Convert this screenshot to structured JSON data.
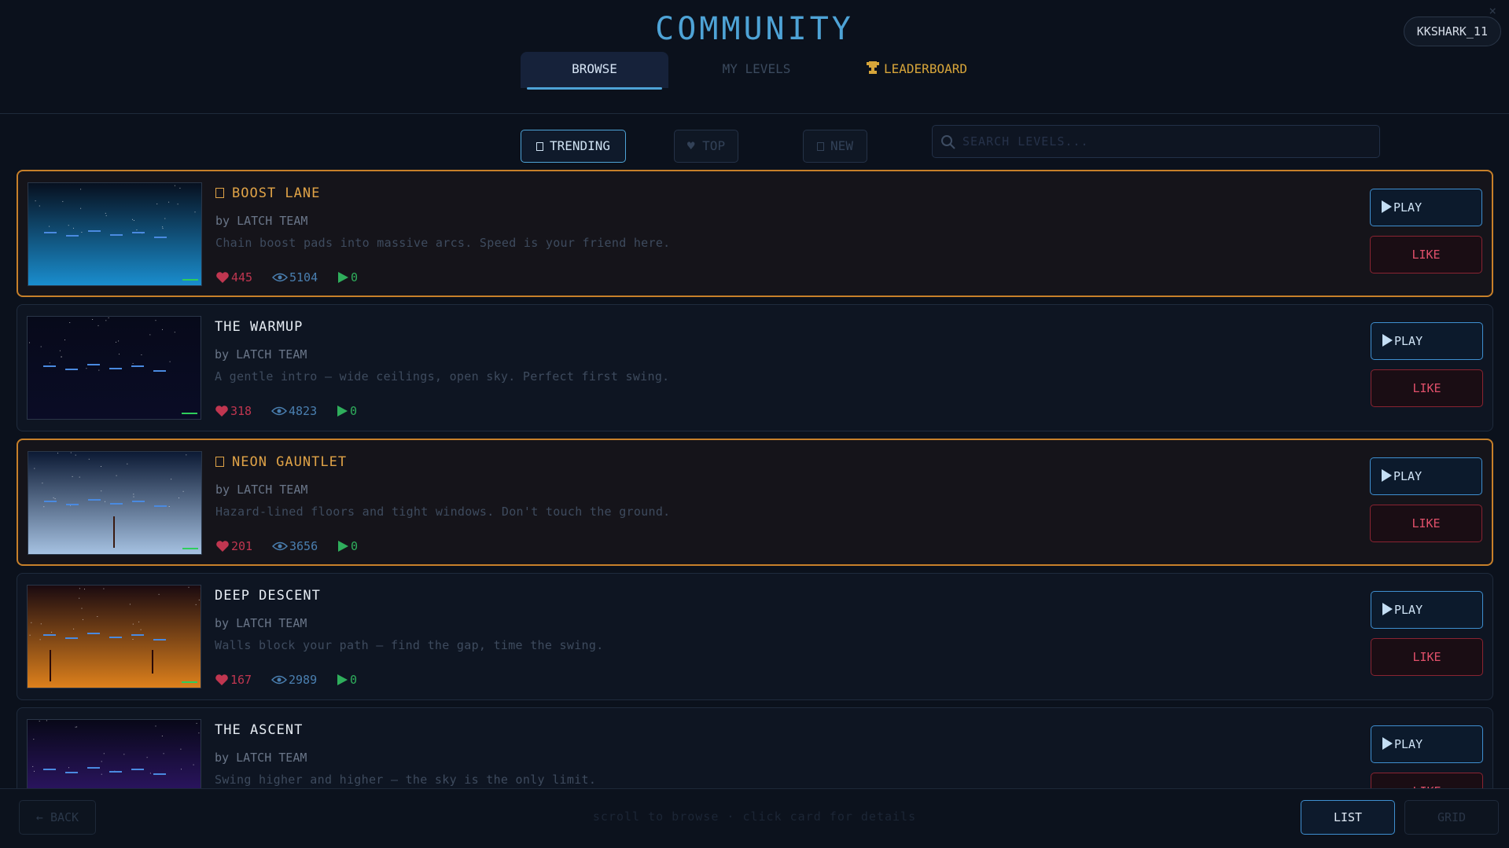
{
  "header": {
    "title": "COMMUNITY",
    "username": "KKSHARK_11",
    "tabs": [
      {
        "label": "BROWSE",
        "active": true
      },
      {
        "label": "MY LEVELS",
        "active": false
      },
      {
        "label": "LEADERBOARD",
        "active": false,
        "icon": "trophy-icon"
      }
    ]
  },
  "filters": {
    "items": [
      {
        "label": "TRENDING",
        "icon": "square-glyph",
        "active": true
      },
      {
        "label": "♥ TOP",
        "active": false
      },
      {
        "label": "NEW",
        "icon": "square-glyph",
        "active": false
      }
    ],
    "search_placeholder": "SEARCH LEVELS..."
  },
  "levels": [
    {
      "title": "BOOST LANE",
      "featured": true,
      "author": "by LATCH TEAM",
      "description": "Chain boost pads into massive arcs. Speed is your friend here.",
      "likes": "445",
      "views": "5104",
      "plays": "0",
      "theme": {
        "top": "#07101f",
        "bottom": "#1a8fd0"
      }
    },
    {
      "title": "THE WARMUP",
      "featured": false,
      "author": "by LATCH TEAM",
      "description": "A gentle intro — wide ceilings, open sky. Perfect first swing.",
      "likes": "318",
      "views": "4823",
      "plays": "0",
      "theme": {
        "top": "#070a1a",
        "bottom": "#0a0c26"
      }
    },
    {
      "title": "NEON GAUNTLET",
      "featured": true,
      "author": "by LATCH TEAM",
      "description": "Hazard-lined floors and tight windows. Don't touch the ground.",
      "likes": "201",
      "views": "3656",
      "plays": "0",
      "theme": {
        "top": "#0c1a34",
        "bottom": "#a8c4e4"
      }
    },
    {
      "title": "DEEP DESCENT",
      "featured": false,
      "author": "by LATCH TEAM",
      "description": "Walls block your path — find the gap, time the swing.",
      "likes": "167",
      "views": "2989",
      "plays": "0",
      "theme": {
        "top": "#1a0a10",
        "bottom": "#e0821c"
      }
    },
    {
      "title": "THE ASCENT",
      "featured": false,
      "author": "by LATCH TEAM",
      "description": "Swing higher and higher — the sky is the only limit.",
      "likes": "",
      "views": "",
      "plays": "",
      "theme": {
        "top": "#080818",
        "bottom": "#3a1a80"
      }
    }
  ],
  "buttons": {
    "play": "PLAY",
    "like": "LIKE"
  },
  "footer": {
    "back": "← BACK",
    "hint": "scroll to browse · click card for details",
    "view_list": "LIST",
    "view_grid": "GRID"
  },
  "colors": {
    "accent": "#4ea3d6",
    "featured": "#c7802a",
    "like": "#c03650",
    "play": "#2fae5c",
    "gold": "#d7a53a"
  }
}
